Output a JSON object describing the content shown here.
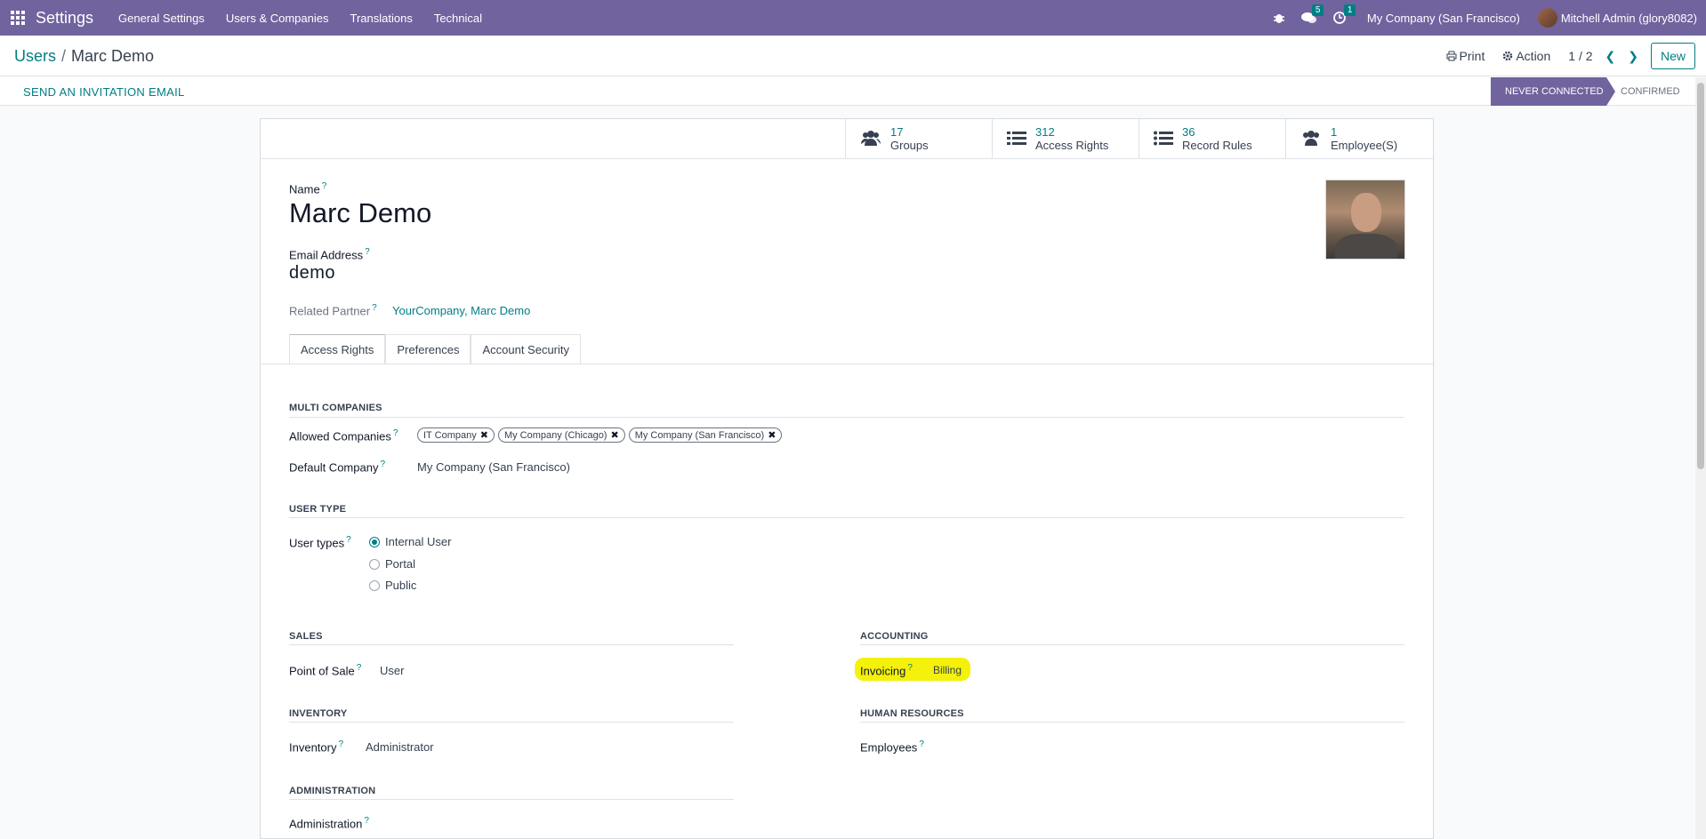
{
  "navbar": {
    "app_title": "Settings",
    "menu": [
      "General Settings",
      "Users & Companies",
      "Translations",
      "Technical"
    ],
    "messages_count": "5",
    "activities_count": "1",
    "company": "My Company (San Francisco)",
    "user": "Mitchell Admin (glory8082)"
  },
  "breadcrumb": {
    "parent": "Users",
    "sep": "/",
    "current": "Marc Demo"
  },
  "control": {
    "print": "Print",
    "action": "Action",
    "pager": "1 / 2",
    "new": "New"
  },
  "status": {
    "invite": "SEND AN INVITATION EMAIL",
    "stage_active": "NEVER CONNECTED",
    "stage_next": "CONFIRMED"
  },
  "stats": [
    {
      "value": "17",
      "label": "Groups"
    },
    {
      "value": "312",
      "label": "Access Rights"
    },
    {
      "value": "36",
      "label": "Record Rules"
    },
    {
      "value": "1",
      "label": "Employee(S)"
    }
  ],
  "form": {
    "name_label": "Name",
    "name": "Marc Demo",
    "email_label": "Email Address",
    "email": "demo",
    "partner_label": "Related Partner",
    "partner": "YourCompany, Marc Demo",
    "tooltip_mark": "?"
  },
  "tabs": [
    "Access Rights",
    "Preferences",
    "Account Security"
  ],
  "multi_companies": {
    "title": "MULTI COMPANIES",
    "allowed_label": "Allowed Companies",
    "allowed": [
      "IT Company",
      "My Company (Chicago)",
      "My Company (San Francisco)"
    ],
    "default_label": "Default Company",
    "default": "My Company (San Francisco)"
  },
  "user_type": {
    "title": "USER TYPE",
    "label": "User types",
    "options": [
      "Internal User",
      "Portal",
      "Public"
    ],
    "selected": "Internal User"
  },
  "sales": {
    "title": "SALES",
    "label": "Point of Sale",
    "value": "User"
  },
  "accounting": {
    "title": "ACCOUNTING",
    "label": "Invoicing",
    "value": "Billing",
    "highlight_color": "#f4f10a"
  },
  "inventory": {
    "title": "INVENTORY",
    "label": "Inventory",
    "value": "Administrator"
  },
  "human_resources": {
    "title": "HUMAN RESOURCES",
    "label": "Employees"
  },
  "administration": {
    "title": "ADMINISTRATION",
    "label": "Administration"
  },
  "colors": {
    "brand": "#71639e",
    "accent": "#017e84"
  }
}
